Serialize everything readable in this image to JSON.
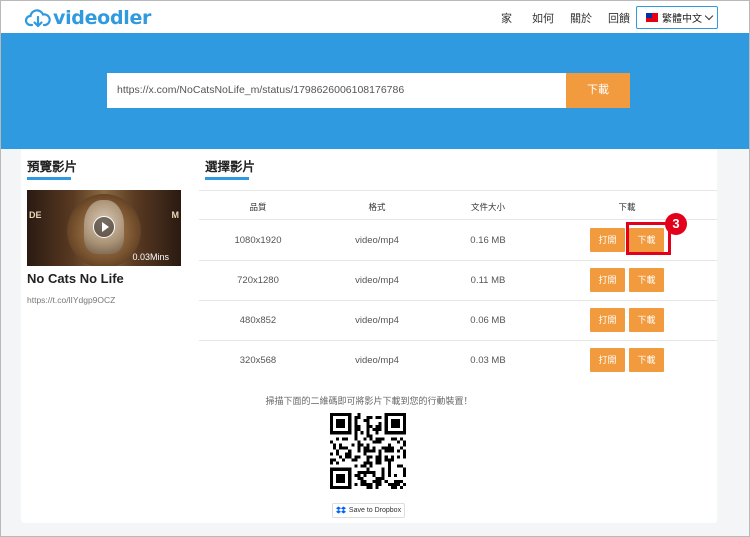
{
  "header": {
    "logo_text": "videodler",
    "nav": [
      "家",
      "如何",
      "關於",
      "回饋"
    ],
    "language": "繁體中文"
  },
  "hero": {
    "url_value": "https://x.com/NoCatsNoLife_m/status/1798626006108176786",
    "download_label": "下載"
  },
  "preview": {
    "title": "預覽影片",
    "duration": "0.03Mins",
    "video_title": "No Cats No Life",
    "short_link": "https://t.co/lIYdgp9OCZ"
  },
  "select": {
    "title": "選擇影片",
    "headers": [
      "品質",
      "格式",
      "文件大小",
      "下載"
    ],
    "rows": [
      {
        "quality": "1080x1920",
        "format": "video/mp4",
        "size": "0.16 MB"
      },
      {
        "quality": "720x1280",
        "format": "video/mp4",
        "size": "0.11 MB"
      },
      {
        "quality": "480x852",
        "format": "video/mp4",
        "size": "0.06 MB"
      },
      {
        "quality": "320x568",
        "format": "video/mp4",
        "size": "0.03 MB"
      }
    ],
    "open_label": "打開",
    "download_label": "下載"
  },
  "annotation": {
    "badge": "3"
  },
  "qr": {
    "caption": "掃描下面的二維碼即可將影片下載到您的行動裝置！",
    "dropbox_label": "Save to Dropbox"
  },
  "colors": {
    "brand_blue": "#2f9ae0",
    "button_orange": "#f19a3e",
    "highlight_red": "#e3001b"
  }
}
